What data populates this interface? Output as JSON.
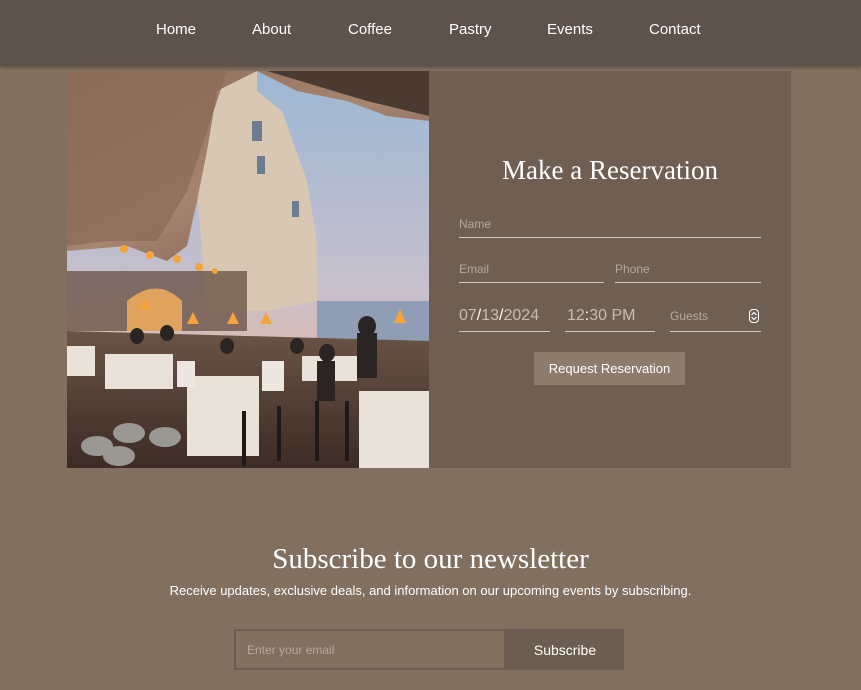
{
  "nav": {
    "items": [
      {
        "label": "Home"
      },
      {
        "label": "About"
      },
      {
        "label": "Coffee"
      },
      {
        "label": "Pastry"
      },
      {
        "label": "Events"
      },
      {
        "label": "Contact"
      }
    ]
  },
  "reservation": {
    "title": "Make a Reservation",
    "name_placeholder": "Name",
    "email_placeholder": "Email",
    "phone_placeholder": "Phone",
    "date": {
      "month": "07",
      "day": "13",
      "year": "2024",
      "sep": "/"
    },
    "time": {
      "hour": "12",
      "minute": "30",
      "ampm": "PM"
    },
    "guests_placeholder": "Guests",
    "button_label": "Request Reservation"
  },
  "newsletter": {
    "title": "Subscribe to our newsletter",
    "subtitle": "Receive updates, exclusive deals, and information on our upcoming events by subscribing.",
    "email_placeholder": "Enter your email",
    "button_label": "Subscribe"
  },
  "colors": {
    "page_bg": "#81705f",
    "nav_bg": "#5e534a",
    "panel_bg": "#6f5f53",
    "button_bg": "#8d7c6c",
    "subscribe_bg": "#6b5d51"
  }
}
